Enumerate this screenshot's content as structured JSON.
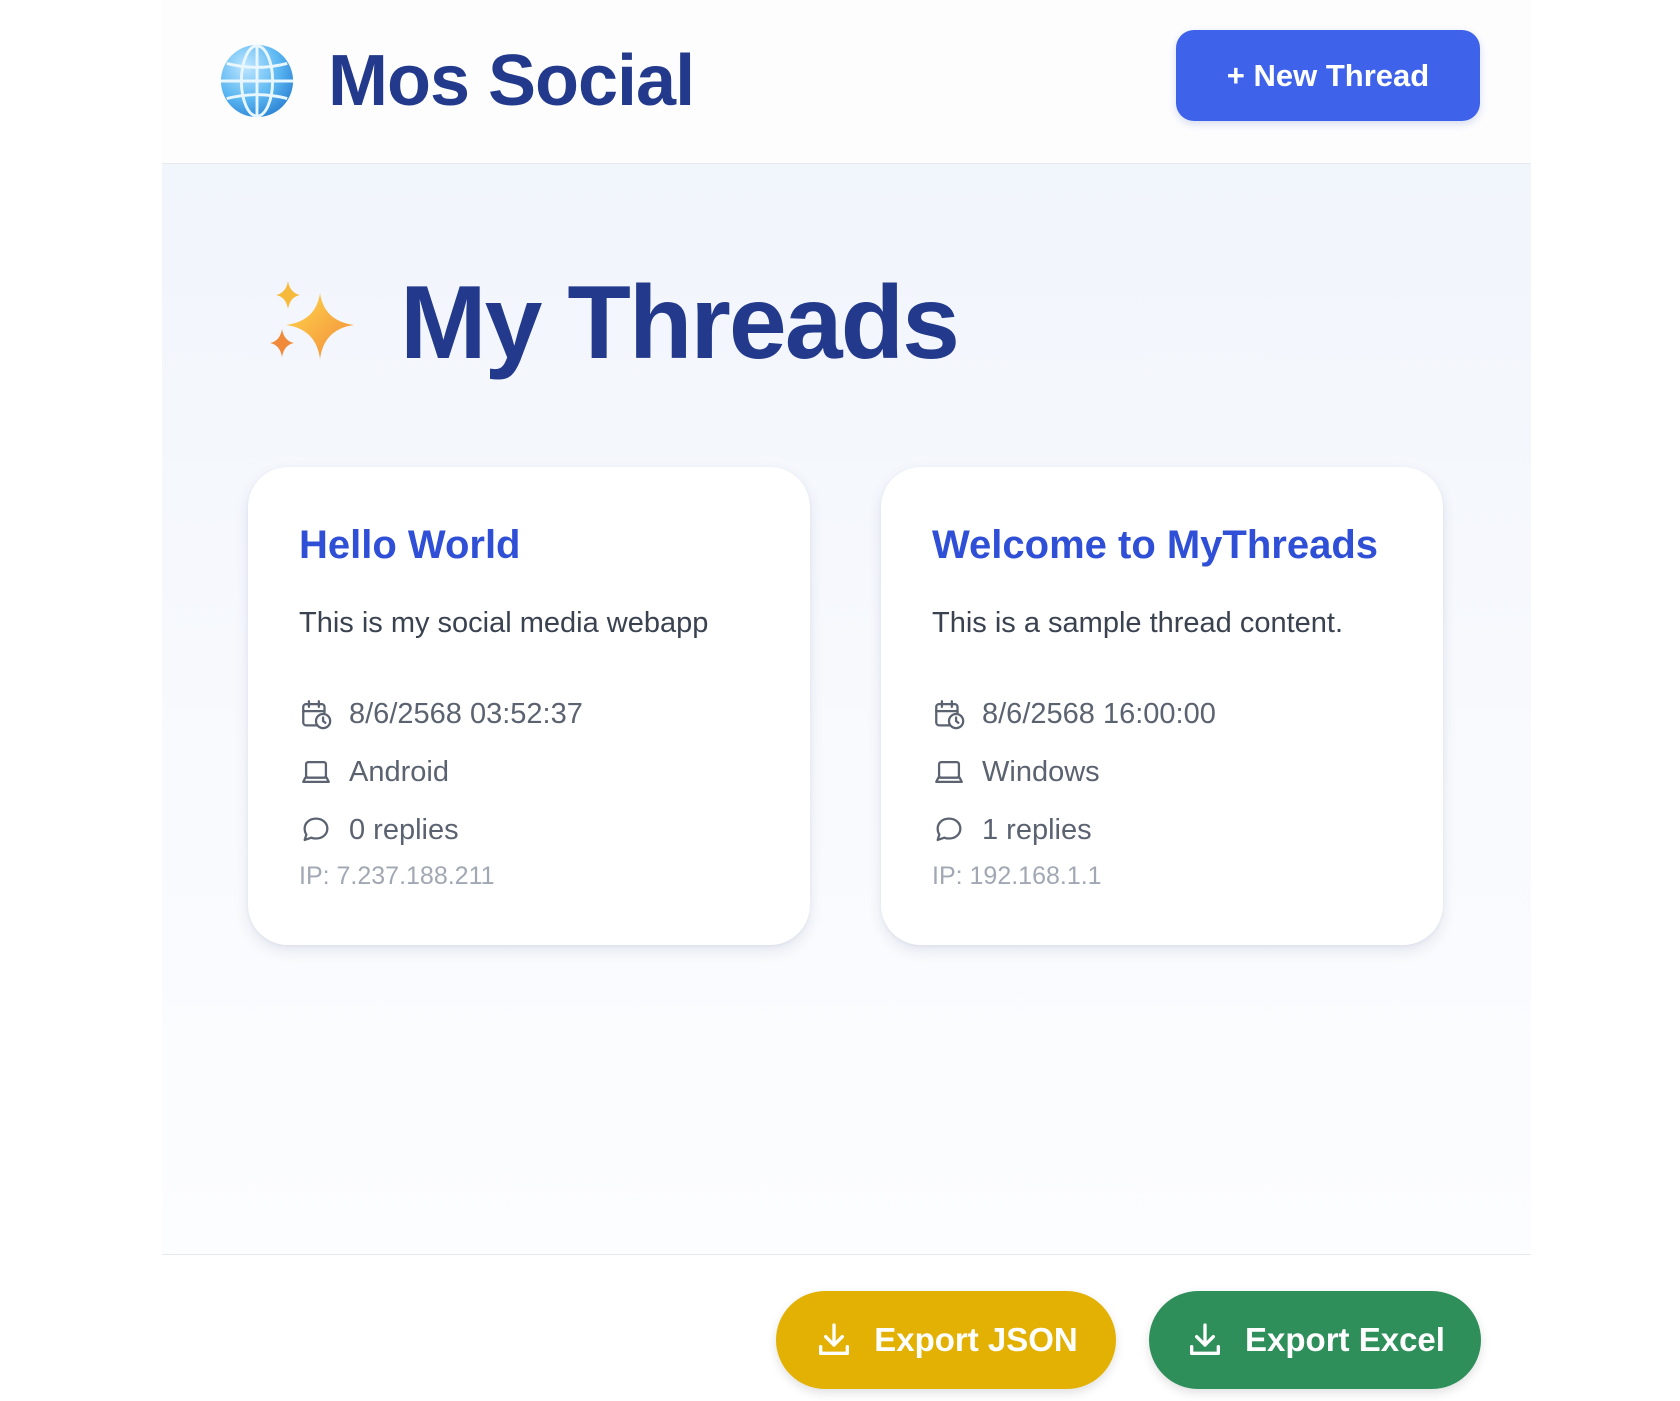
{
  "header": {
    "brand_icon": "globe-icon",
    "brand_title": "Mos Social",
    "new_thread_label": "+ New Thread"
  },
  "main": {
    "title_icon": "sparkles-icon",
    "title": "My Threads",
    "threads": [
      {
        "title": "Hello World",
        "content": "This is my social media webapp",
        "date": "8/6/2568 03:52:37",
        "device": "Android",
        "replies": "0 replies",
        "ip": "IP: 7.237.188.211"
      },
      {
        "title": "Welcome to MyThreads",
        "content": "This is a sample thread content.",
        "date": "8/6/2568 16:00:00",
        "device": "Windows",
        "replies": "1 replies",
        "ip": "IP: 192.168.1.1"
      }
    ]
  },
  "footer": {
    "export_json_label": "Export JSON",
    "export_excel_label": "Export Excel",
    "export_icon": "download-icon"
  },
  "colors": {
    "primary": "#3e63ea",
    "heading": "#233a8c",
    "link_title": "#2f4fd6",
    "export_json": "#e3b103",
    "export_excel": "#2f8f5b"
  }
}
